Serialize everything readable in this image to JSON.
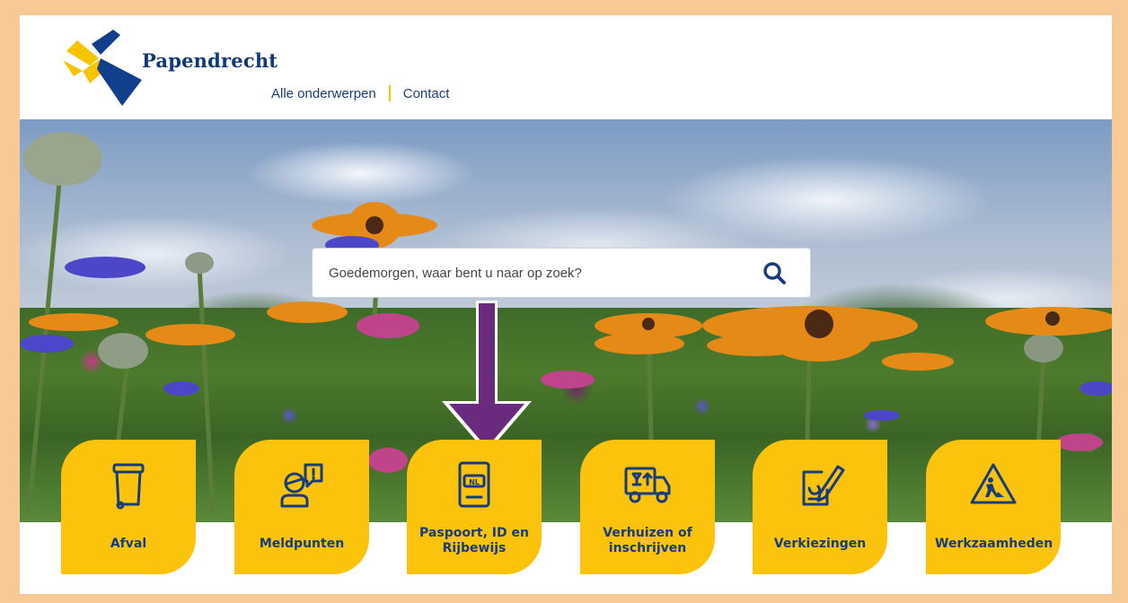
{
  "header": {
    "logo_text": "Papendrecht",
    "nav": [
      {
        "label": "Alle onderwerpen"
      },
      {
        "label": "Contact"
      }
    ]
  },
  "search": {
    "placeholder": "Goedemorgen, waar bent u naar op zoek?",
    "icon": "search-icon"
  },
  "tiles": [
    {
      "label": "Afval",
      "icon": "waste-bin-icon"
    },
    {
      "label": "Meldpunten",
      "icon": "report-person-icon"
    },
    {
      "label": "Paspoort, ID en Rijbewijs",
      "icon": "passport-icon"
    },
    {
      "label": "Verhuizen of inschrijven",
      "icon": "moving-truck-icon"
    },
    {
      "label": "Verkiezingen",
      "icon": "ballot-vote-icon"
    },
    {
      "label": "Werkzaamheden",
      "icon": "roadwork-sign-icon"
    }
  ],
  "annotation": {
    "arrow_color": "#6a2a7e",
    "arrow_icon": "down-arrow-icon"
  },
  "colors": {
    "brand_blue": "#173c7e",
    "tile_yellow": "#fbc30c",
    "frame": "#f6c995"
  }
}
